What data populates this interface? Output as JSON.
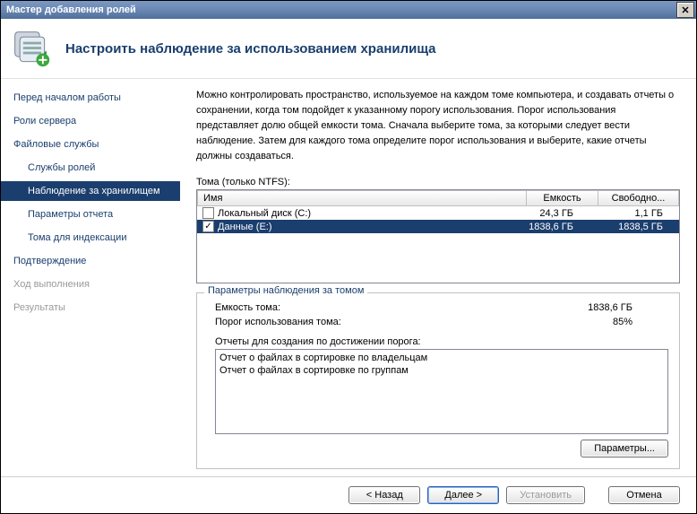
{
  "window": {
    "title": "Мастер добавления ролей"
  },
  "header": {
    "title": "Настроить наблюдение за использованием хранилища"
  },
  "sidebar": {
    "items": [
      {
        "label": "Перед началом работы",
        "sub": false,
        "sel": false,
        "disabled": false
      },
      {
        "label": "Роли сервера",
        "sub": false,
        "sel": false,
        "disabled": false
      },
      {
        "label": "Файловые службы",
        "sub": false,
        "sel": false,
        "disabled": false
      },
      {
        "label": "Службы ролей",
        "sub": true,
        "sel": false,
        "disabled": false
      },
      {
        "label": "Наблюдение за хранилищем",
        "sub": true,
        "sel": true,
        "disabled": false
      },
      {
        "label": "Параметры отчета",
        "sub": true,
        "sel": false,
        "disabled": false
      },
      {
        "label": "Тома для индексации",
        "sub": true,
        "sel": false,
        "disabled": false
      },
      {
        "label": "Подтверждение",
        "sub": false,
        "sel": false,
        "disabled": false
      },
      {
        "label": "Ход выполнения",
        "sub": false,
        "sel": false,
        "disabled": true
      },
      {
        "label": "Результаты",
        "sub": false,
        "sel": false,
        "disabled": true
      }
    ]
  },
  "main": {
    "description": "Можно контролировать пространство, используемое на каждом томе компьютера, и создавать отчеты о сохранении, когда том подойдет к указанному порогу использования.  Порог использования представляет долю общей емкости тома. Сначала выберите тома, за которыми следует вести наблюдение.  Затем для каждого тома определите порог использования и выберите, какие отчеты должны создаваться.",
    "volumes_label": "Тома (только NTFS):",
    "columns": {
      "name": "Имя",
      "capacity": "Емкость",
      "free": "Свободно..."
    },
    "rows": [
      {
        "checked": false,
        "name": "Локальный диск (C:)",
        "capacity": "24,3 ГБ",
        "free": "1,1 ГБ",
        "selected": false
      },
      {
        "checked": true,
        "name": "Данные (E:)",
        "capacity": "1838,6 ГБ",
        "free": "1838,5 ГБ",
        "selected": true
      }
    ]
  },
  "options": {
    "legend": "Параметры наблюдения за томом",
    "capacity_label": "Емкость тома:",
    "capacity_value": "1838,6 ГБ",
    "threshold_label": "Порог использования тома:",
    "threshold_value": "85%",
    "reports_label": "Отчеты для создания по достижении порога:",
    "reports": [
      "Отчет о файлах в сортировке по владельцам",
      "Отчет о файлах в сортировке по группам"
    ],
    "params_btn": "Параметры..."
  },
  "footer": {
    "back": "< Назад",
    "next": "Далее >",
    "install": "Установить",
    "cancel": "Отмена"
  }
}
